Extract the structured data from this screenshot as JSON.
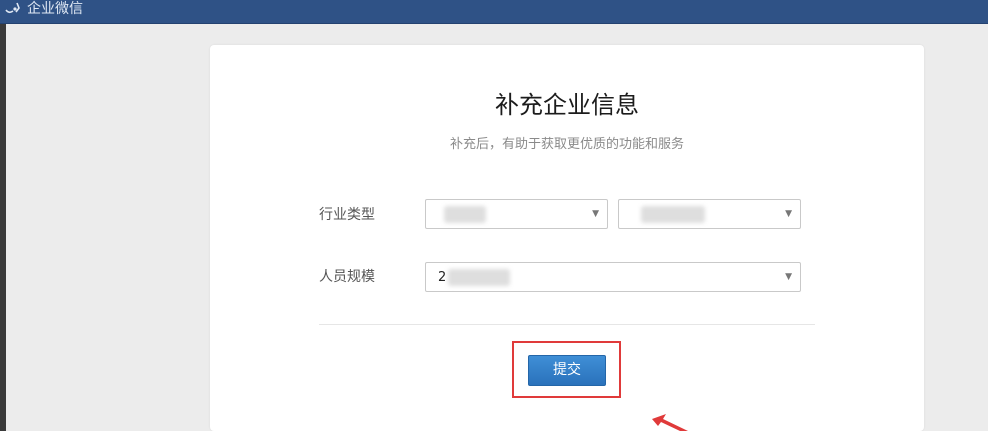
{
  "header": {
    "brand_text": "企业微信",
    "brand_icon": "wework-logo-icon"
  },
  "form": {
    "title": "补充企业信息",
    "subtitle": "补充后，有助于获取更优质的功能和服务",
    "industry": {
      "label": "行业类型",
      "primary_value": "",
      "secondary_value": ""
    },
    "staff_size": {
      "label": "人员规模",
      "value": "2"
    },
    "submit_label": "提交"
  },
  "colors": {
    "topbar": "#2f5286",
    "primary_button": "#2a72bb",
    "highlight": "#e03a3a",
    "annotation_arrow": "#e03a3a"
  }
}
